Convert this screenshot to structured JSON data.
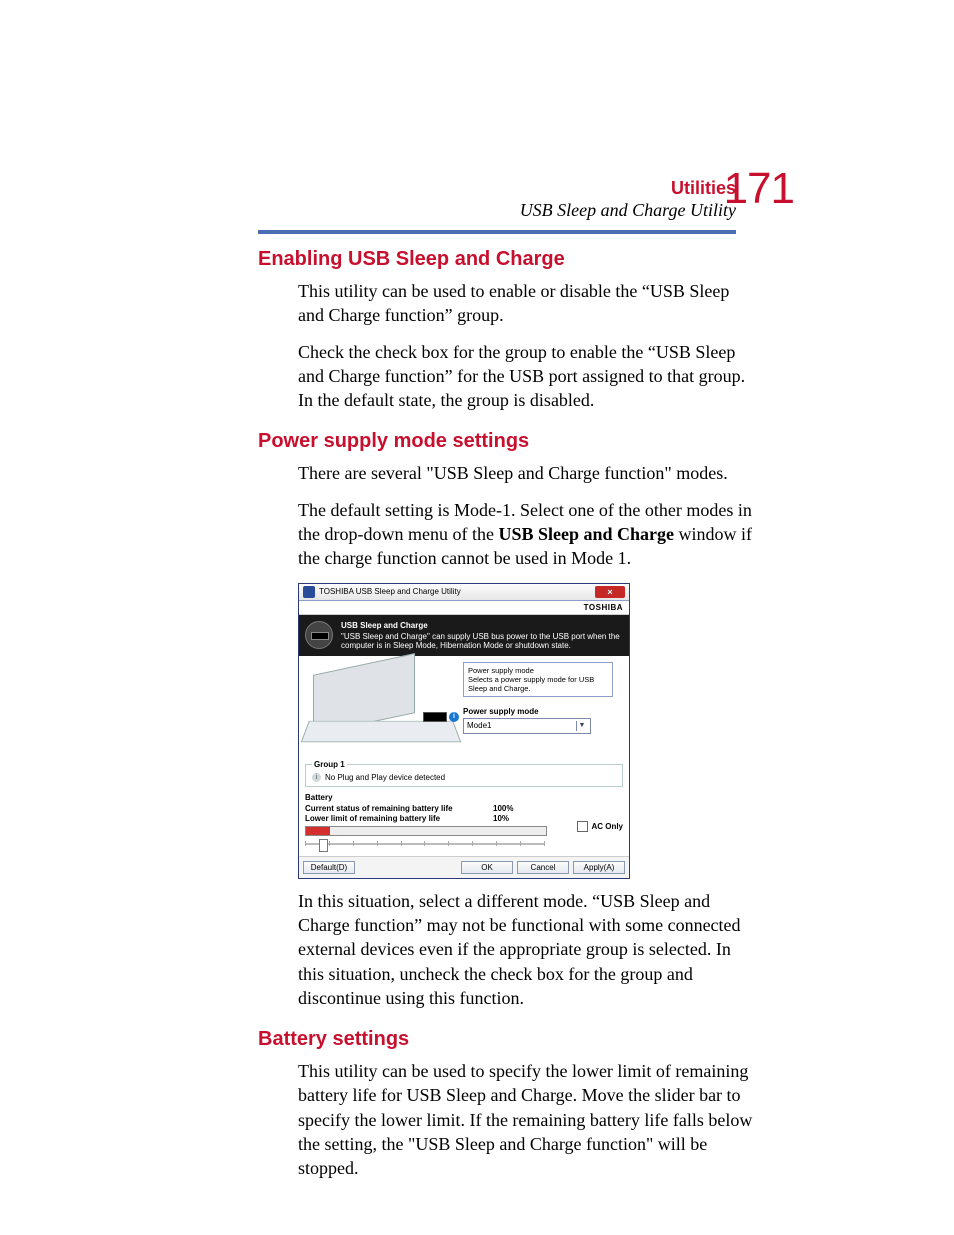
{
  "header": {
    "category": "Utilities",
    "subtitle": "USB Sleep and Charge Utility",
    "page_number": "171"
  },
  "section1": {
    "heading": "Enabling USB Sleep and Charge",
    "p1": "This utility can be used to enable or disable the “USB Sleep and Charge function” group.",
    "p2": "Check the check box for the group to enable the “USB Sleep and Charge function” for the USB port assigned to that group. In the default state, the group is disabled."
  },
  "section2": {
    "heading": "Power supply mode settings",
    "p1": "There are several \"USB Sleep and Charge function\" modes.",
    "p2a": "The default setting is Mode-1. Select one of the other modes in the drop-down menu of the ",
    "p2b_bold": "USB Sleep and Charge",
    "p2c": " window if the charge function cannot be used in Mode 1.",
    "p_after": "In this situation, select a different mode. “USB Sleep and Charge function” may not be functional with some connected external devices even if the appropriate group is selected. In this situation, uncheck the check box for the group and discontinue using this function."
  },
  "section3": {
    "heading": "Battery settings",
    "p1": "This utility can be used to specify the lower limit of remaining battery life for USB Sleep and Charge. Move the slider bar to specify the lower limit. If the remaining battery life falls below the setting, the \"USB Sleep and Charge function\" will be stopped."
  },
  "screenshot": {
    "window_title": "TOSHIBA USB Sleep and Charge Utility",
    "brand": "TOSHIBA",
    "desc_title": "USB Sleep and Charge",
    "desc_body": "\"USB Sleep and Charge\" can supply USB bus power to the USB port when the  computer is in Sleep Mode, Hibernation Mode or shutdown state.",
    "tooltip_title": "Power supply mode",
    "tooltip_body": "Selects a power supply mode for USB Sleep and Charge.",
    "psm_label": "Power supply mode",
    "psm_value": "Mode1",
    "group1_legend": "Group 1",
    "group1_msg": "No Plug and Play device detected",
    "battery_heading": "Battery",
    "kv1_label": "Current status of remaining battery life",
    "kv1_value": "100%",
    "kv2_label": "Lower limit of remaining battery life",
    "kv2_value": "10%",
    "ac_only": "AC Only",
    "buttons": {
      "default": "Default(D)",
      "ok": "OK",
      "cancel": "Cancel",
      "apply": "Apply(A)"
    }
  }
}
